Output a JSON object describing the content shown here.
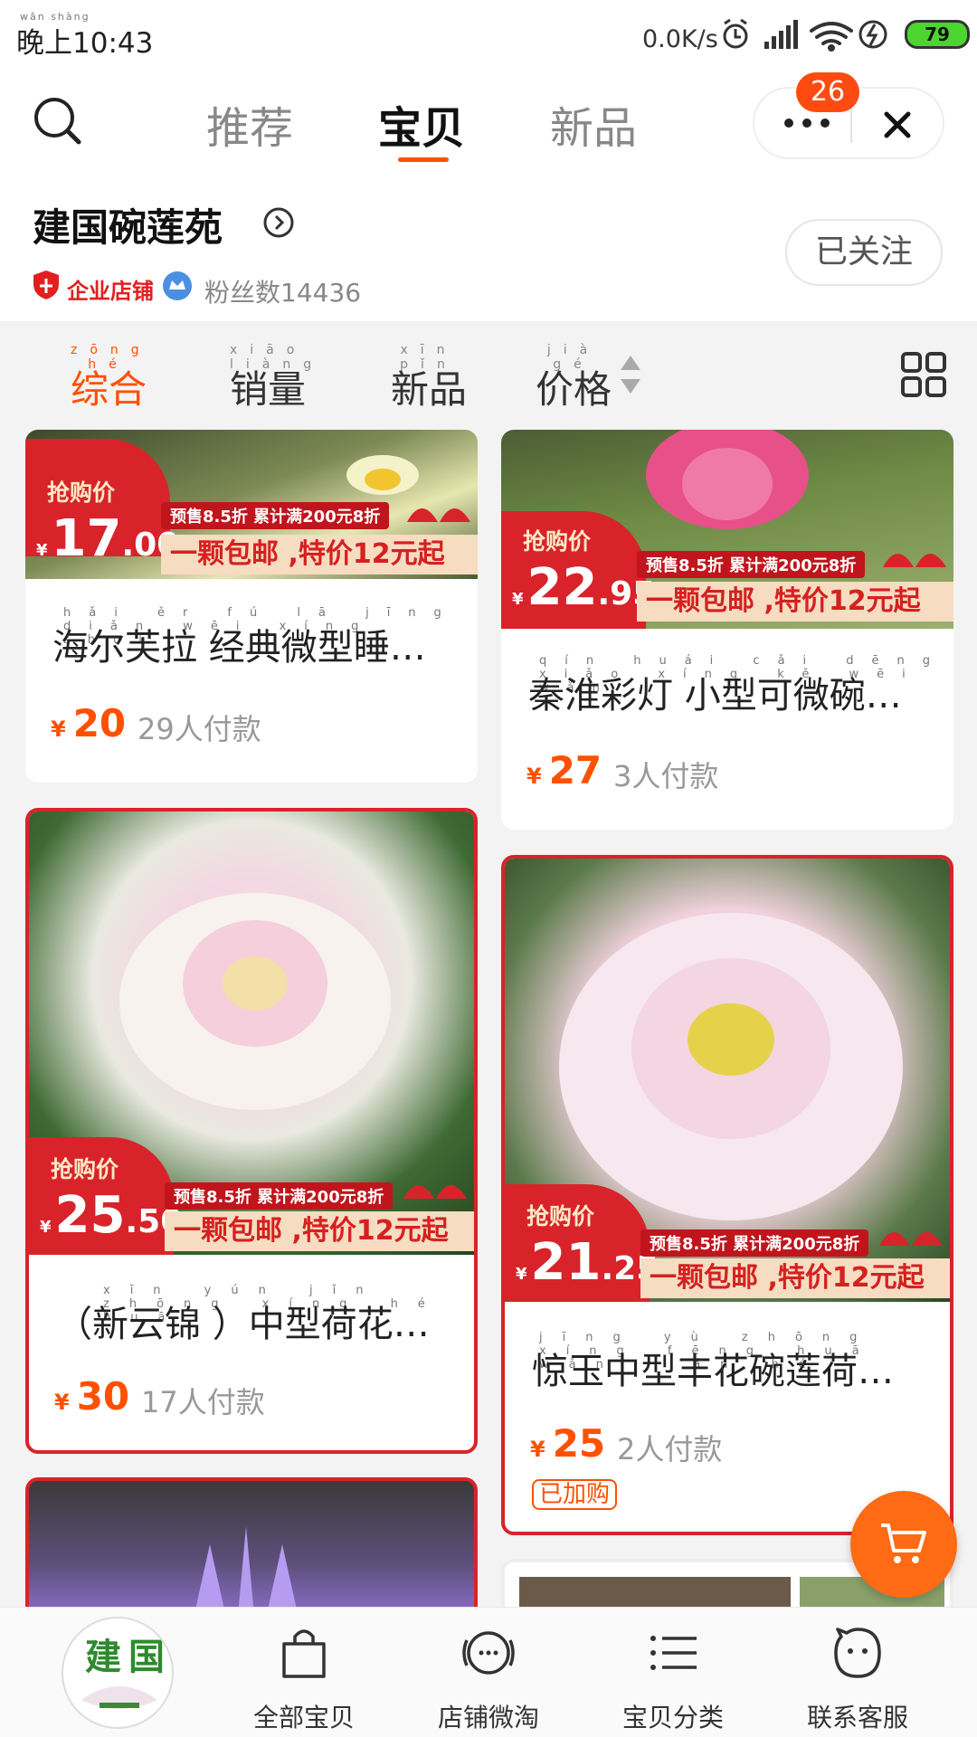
{
  "status_bar": {
    "time": "晚上10:43",
    "time_pinyin": "wǎn shàng",
    "net_speed": "0.0K/s",
    "battery": "79"
  },
  "nav": {
    "tabs": [
      {
        "label": "推荐"
      },
      {
        "label": "宝贝"
      },
      {
        "label": "新品"
      }
    ],
    "active_tab": "宝贝",
    "message_badge": "26"
  },
  "shop": {
    "name": "建国碗莲苑",
    "tag": "企业店铺",
    "fans": "粉丝数14436",
    "follow_label": "已关注"
  },
  "sort": {
    "items": [
      {
        "label": "综合",
        "pinyin": "zōng hé"
      },
      {
        "label": "销量",
        "pinyin": "xiāo liàng"
      },
      {
        "label": "新品",
        "pinyin": "xīn pǐn"
      },
      {
        "label": "价格",
        "pinyin": "jià gé"
      }
    ],
    "active": "综合"
  },
  "products": [
    {
      "title": "海尔芙拉 经典微型睡…",
      "promo_label": "抢购价",
      "promo_int": "17",
      "promo_dec": ".00",
      "promo_mini": "预售8.5折 累计满200元8折",
      "promo_strip": "一颗包邮 ,特价12元起",
      "price": "20",
      "sold": "29人付款"
    },
    {
      "title": "秦淮彩灯 小型可微碗…",
      "promo_label": "抢购价",
      "promo_int": "22",
      "promo_dec": ".95",
      "promo_mini": "预售8.5折 累计满200元8折",
      "promo_strip": "一颗包邮 ,特价12元起",
      "price": "27",
      "sold": "3人付款"
    },
    {
      "title": "（新云锦 ）中型荷花…",
      "promo_label": "抢购价",
      "promo_int": "25",
      "promo_dec": ".50",
      "promo_mini": "预售8.5折 累计满200元8折",
      "promo_strip": "一颗包邮 ,特价12元起",
      "price": "30",
      "sold": "17人付款"
    },
    {
      "title": "惊玉中型丰花碗莲荷…",
      "promo_label": "抢购价",
      "promo_int": "21",
      "promo_dec": ".25",
      "promo_mini": "预售8.5折 累计满200元8折",
      "promo_strip": "一颗包邮 ,特价12元起",
      "price": "25",
      "sold": "2人付款",
      "bought_tag": "已加购"
    }
  ],
  "currency": "¥",
  "bottom_bar": {
    "logo_text": "建国",
    "items": [
      {
        "label": "全部宝贝",
        "icon": "bag-icon"
      },
      {
        "label": "店铺微淘",
        "icon": "broadcast-icon"
      },
      {
        "label": "宝贝分类",
        "icon": "list-icon"
      },
      {
        "label": "联系客服",
        "icon": "chat-face-icon"
      }
    ]
  },
  "colors": {
    "accent": "#ff5000",
    "promo_red": "#d8232a",
    "cart_fab": "#ff6a14"
  }
}
